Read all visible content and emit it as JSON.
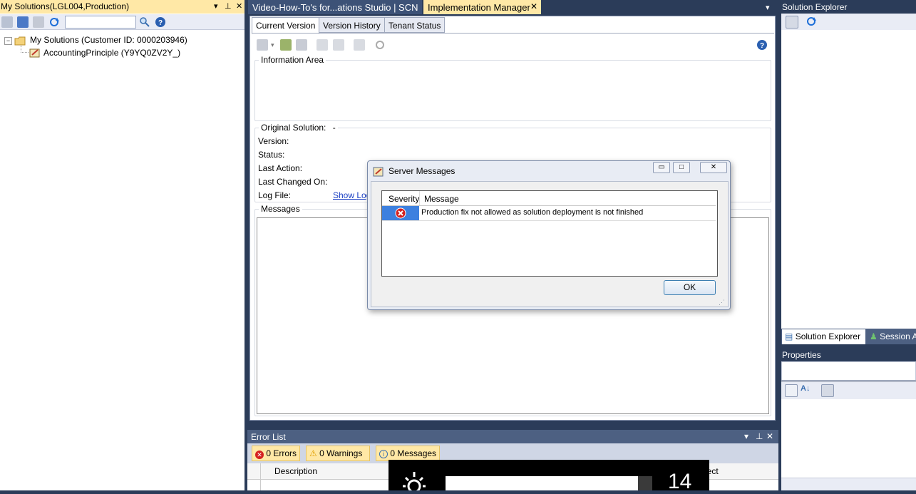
{
  "left_panel": {
    "title": "My Solutions(LGL004,Production)",
    "tree": {
      "root": "My Solutions (Customer ID: 0000203946)",
      "child": "AccountingPrinciple (Y9YQ0ZV2Y_)"
    }
  },
  "document_tabs": [
    {
      "label": "Video-How-To's for...ations Studio | SCN",
      "active": false
    },
    {
      "label": "Implementation Manager",
      "active": true
    }
  ],
  "sub_tabs": [
    "Current Version",
    "Version History",
    "Tenant Status"
  ],
  "information_area": {
    "label": "Information Area"
  },
  "original_solution": {
    "label": "Original Solution:",
    "value": "-",
    "fields": [
      "Version:",
      "Status:",
      "Last Action:",
      "Last Changed On:",
      "Log File:"
    ],
    "log_link": "Show Log"
  },
  "messages_group": {
    "label": "Messages"
  },
  "dialog": {
    "title": "Server Messages",
    "columns": [
      "Severity",
      "Message"
    ],
    "rows": [
      {
        "severity": "error",
        "message": "Production fix not allowed as solution deployment is not finished"
      }
    ],
    "ok_label": "OK"
  },
  "error_list": {
    "title": "Error List",
    "errors": "0 Errors",
    "warnings": "0 Warnings",
    "messages": "0 Messages",
    "columns": [
      "Description",
      "ject"
    ]
  },
  "right_panel": {
    "solution_explorer_title": "Solution Explorer",
    "tabs": [
      "Solution Explorer",
      "Session A"
    ],
    "properties_title": "Properties"
  },
  "overlay": {
    "number": "14"
  },
  "colors": {
    "active_tab": "#ffe8a6",
    "frame": "#2b3c59",
    "selection": "#3d80df",
    "error_red": "#d42020"
  }
}
